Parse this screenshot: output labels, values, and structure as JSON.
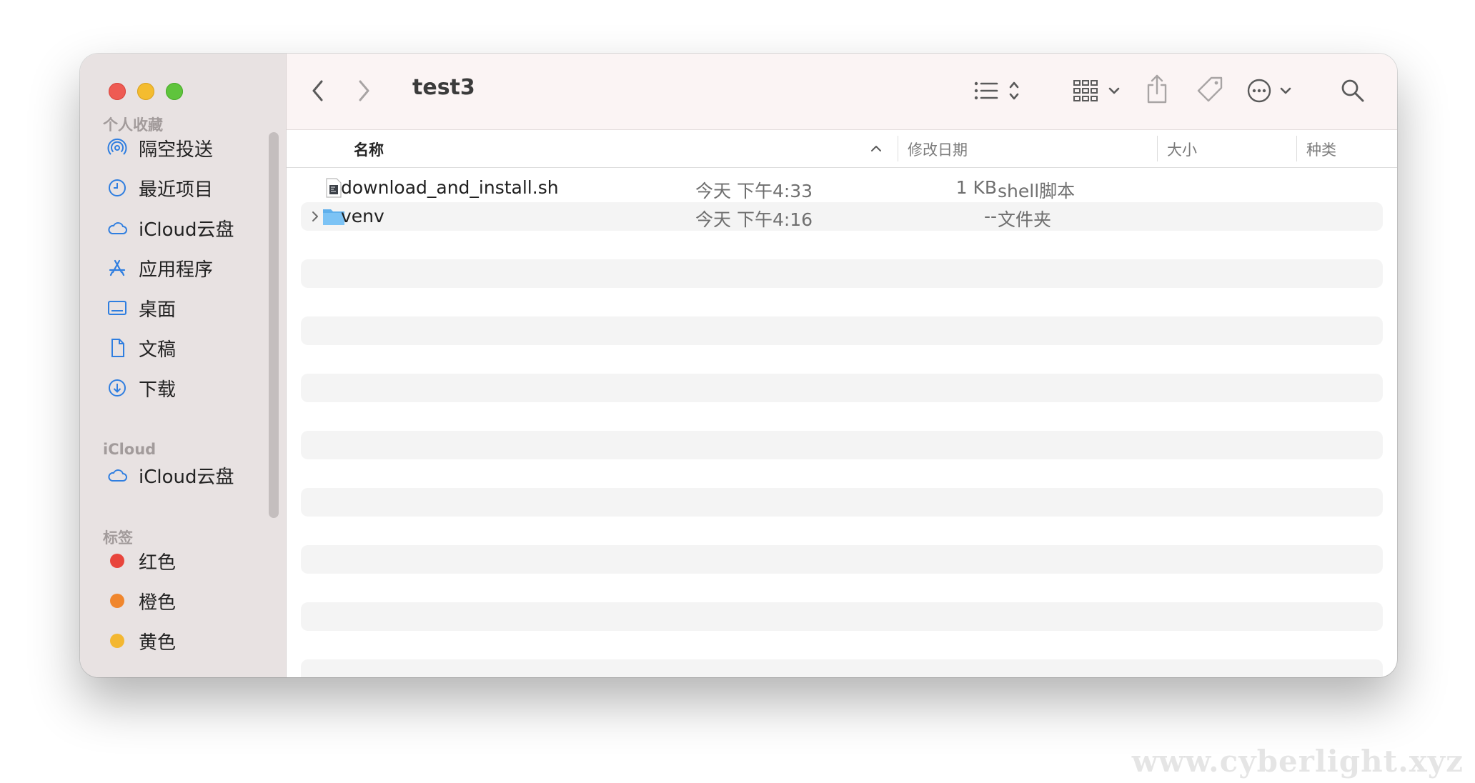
{
  "window": {
    "title": "test3"
  },
  "sidebar": {
    "sections": [
      {
        "label": "个人收藏"
      },
      {
        "label": "iCloud"
      },
      {
        "label": "标签"
      }
    ],
    "favorites": [
      {
        "label": "隔空投送",
        "icon": "airdrop-icon"
      },
      {
        "label": "最近项目",
        "icon": "clock-icon"
      },
      {
        "label": "iCloud云盘",
        "icon": "cloud-icon"
      },
      {
        "label": "应用程序",
        "icon": "app-store-icon"
      },
      {
        "label": "桌面",
        "icon": "desktop-icon"
      },
      {
        "label": "文稿",
        "icon": "document-icon"
      },
      {
        "label": "下载",
        "icon": "download-icon"
      }
    ],
    "icloud": [
      {
        "label": "iCloud云盘",
        "icon": "cloud-icon"
      }
    ],
    "tags": [
      {
        "label": "红色",
        "color": "#e8453c"
      },
      {
        "label": "橙色",
        "color": "#f0862d"
      },
      {
        "label": "黄色",
        "color": "#f3b731"
      }
    ]
  },
  "toolbar": {
    "back_icon": "chevron-left-icon",
    "forward_icon": "chevron-right-icon",
    "view_icon": "list-view-icon",
    "group_icon": "grid-group-icon",
    "share_icon": "share-icon",
    "tag_icon": "tag-icon",
    "more_icon": "ellipsis-circle-icon",
    "search_icon": "search-icon"
  },
  "columns": {
    "name": "名称",
    "modified": "修改日期",
    "size": "大小",
    "kind": "种类"
  },
  "files": [
    {
      "name": "download_and_install.sh",
      "modified": "今天 下午4:33",
      "size": "1 KB",
      "kind": "shell脚本",
      "icon": "shell-script-icon"
    },
    {
      "name": "venv",
      "modified": "今天 下午4:16",
      "size": "--",
      "kind": "文件夹",
      "icon": "folder-icon"
    }
  ],
  "watermark": "www.cyberlight.xyz"
}
